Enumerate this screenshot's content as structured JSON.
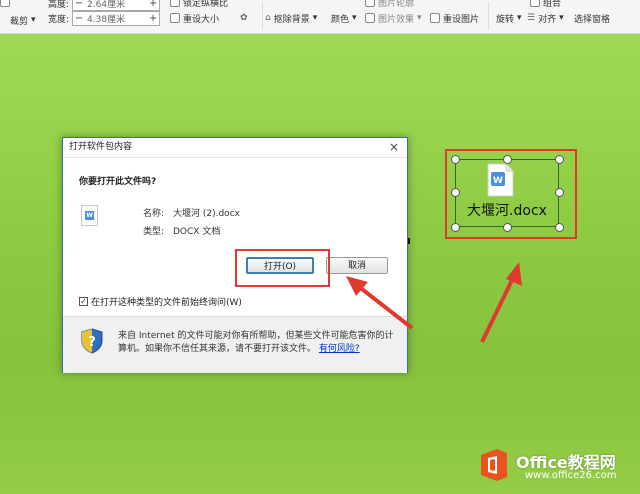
{
  "ribbon": {
    "height_label": "高度:",
    "height_value": "2.64厘米",
    "width_label": "宽度:",
    "width_value": "4.38厘米",
    "minus": "−",
    "plus": "+",
    "lock_ratio": "锁定纵横比",
    "reset_size": "重设大小",
    "crop": "裁剪",
    "remove_bg": "抠除背景",
    "color": "颜色",
    "picture_effect": "图片效果",
    "reset_picture": "重设图片",
    "rotate": "旋转",
    "align": "对齐",
    "select_pane": "选择窗格",
    "picture_border": "图片轮廓",
    "group": "组合"
  },
  "dialog": {
    "title": "打开软件包内容",
    "close": "×",
    "question": "你要打开此文件吗?",
    "name_label": "名称:",
    "name_value": "大堰河 (2).docx",
    "type_label": "类型:",
    "type_value": "DOCX 文档",
    "open_button": "打开(O)",
    "cancel_button": "取消",
    "checkbox_label": "在打开这种类型的文件前始终询问(W)",
    "checkbox_checked": true,
    "warning_text": "来自 Internet 的文件可能对你有所帮助，但某些文件可能危害你的计算机。如果你不信任其来源，请不要打开该文件。",
    "warning_link": "有何风险?"
  },
  "embedded_object": {
    "label": "大堰河.docx"
  },
  "watermark": {
    "brand": "Office教程网",
    "url": "www.office26.com"
  },
  "colors": {
    "canvas_green": "#93d048",
    "highlight_red": "#e03a2e",
    "word_blue": "#4a8fe0",
    "office_orange": "#e8531e"
  }
}
